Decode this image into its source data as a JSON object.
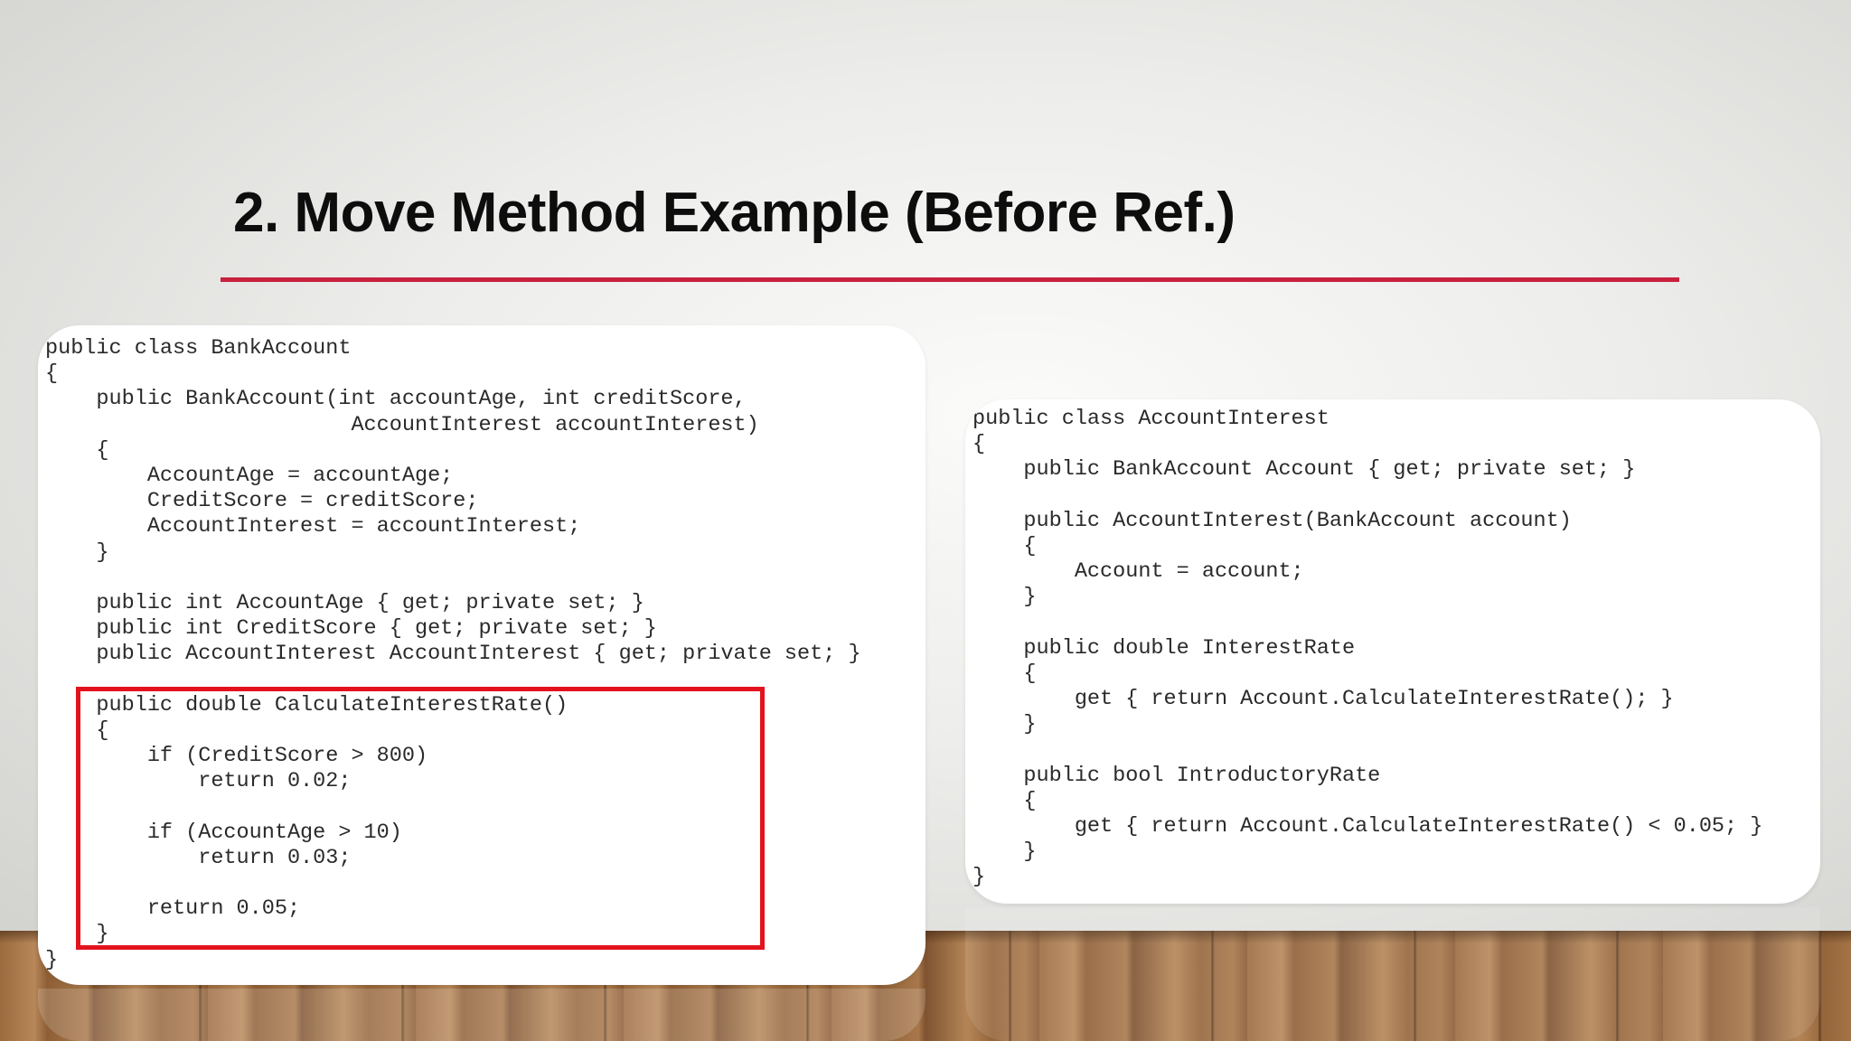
{
  "slide": {
    "title": "2. Move Method Example (Before Ref.)",
    "accent_color": "#c8203f",
    "highlight_color": "#e3131d"
  },
  "left_code": {
    "lines": [
      "public class BankAccount",
      "{",
      "    public BankAccount(int accountAge, int creditScore,",
      "                        AccountInterest accountInterest)",
      "    {",
      "        AccountAge = accountAge;",
      "        CreditScore = creditScore;",
      "        AccountInterest = accountInterest;",
      "    }",
      "",
      "    public int AccountAge { get; private set; }",
      "    public int CreditScore { get; private set; }",
      "    public AccountInterest AccountInterest { get; private set; }",
      "",
      "    public double CalculateInterestRate()",
      "    {",
      "        if (CreditScore > 800)",
      "            return 0.02;",
      "",
      "        if (AccountAge > 10)",
      "            return 0.03;",
      "",
      "        return 0.05;",
      "    }",
      "}"
    ]
  },
  "right_code": {
    "lines": [
      "public class AccountInterest",
      "{",
      "    public BankAccount Account { get; private set; }",
      "",
      "    public AccountInterest(BankAccount account)",
      "    {",
      "        Account = account;",
      "    }",
      "",
      "    public double InterestRate",
      "    {",
      "        get { return Account.CalculateInterestRate(); }",
      "    }",
      "",
      "    public bool IntroductoryRate",
      "    {",
      "        get { return Account.CalculateInterestRate() < 0.05; }",
      "    }",
      "}"
    ]
  }
}
